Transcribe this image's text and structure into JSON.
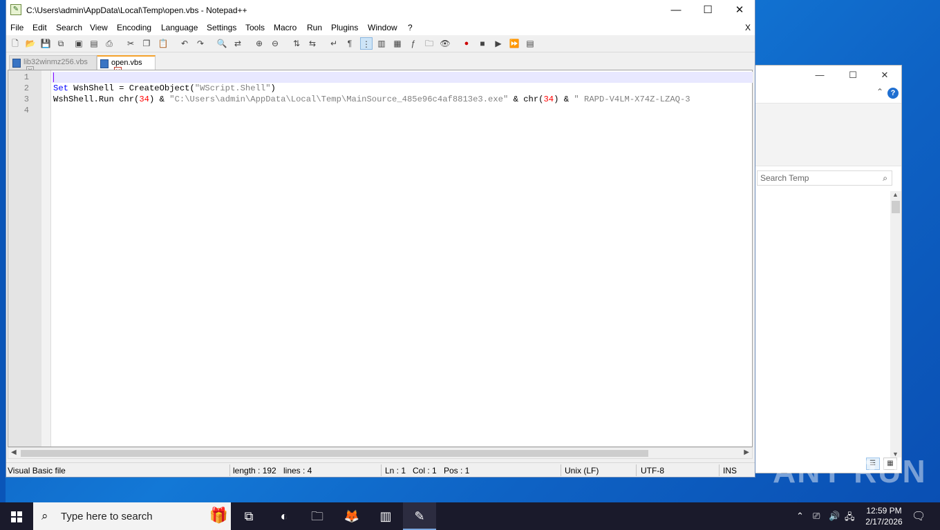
{
  "notepad": {
    "title": "C:\\Users\\admin\\AppData\\Local\\Temp\\open.vbs - Notepad++",
    "controls": {
      "minimize": "—",
      "maximize": "☐",
      "close": "✕"
    },
    "menu": [
      "File",
      "Edit",
      "Search",
      "View",
      "Encoding",
      "Language",
      "Settings",
      "Tools",
      "Macro",
      "Run",
      "Plugins",
      "Window",
      "?"
    ],
    "menu_close": "X",
    "tabs": [
      {
        "label": "lib32winmz256.vbs",
        "active": false
      },
      {
        "label": "open.vbs",
        "active": true
      }
    ],
    "tab_close_glyph": "✕",
    "line_numbers": [
      "1",
      "2",
      "3",
      "4"
    ],
    "code": {
      "line2": {
        "kw": "Set",
        "rest1": " WshShell = CreateObject(",
        "str": "\"WScript.Shell\"",
        "rest2": ")"
      },
      "line3": {
        "a": "WshShell.Run chr(",
        "n1": "34",
        "b": ") & ",
        "s1": "\"C:\\Users\\admin\\AppData\\Local\\Temp\\MainSource_485e96c4af8813e3.exe\"",
        "c": " & chr(",
        "n2": "34",
        "d": ") & ",
        "s2": "\" RAPD-V4LM-X74Z-LZAQ-3"
      }
    },
    "status": {
      "filetype": "Visual Basic file",
      "length": "length : 192",
      "lines": "lines : 4",
      "ln": "Ln : 1",
      "col": "Col : 1",
      "pos": "Pos : 1",
      "eol": "Unix (LF)",
      "encoding": "UTF-8",
      "mode": "INS"
    }
  },
  "explorer": {
    "search_placeholder": "Search Temp",
    "help": "?"
  },
  "watermark": "ANY RUN",
  "taskbar": {
    "search_placeholder": "Type here to search",
    "time": "12:59 PM",
    "date": "2/17/2026"
  }
}
